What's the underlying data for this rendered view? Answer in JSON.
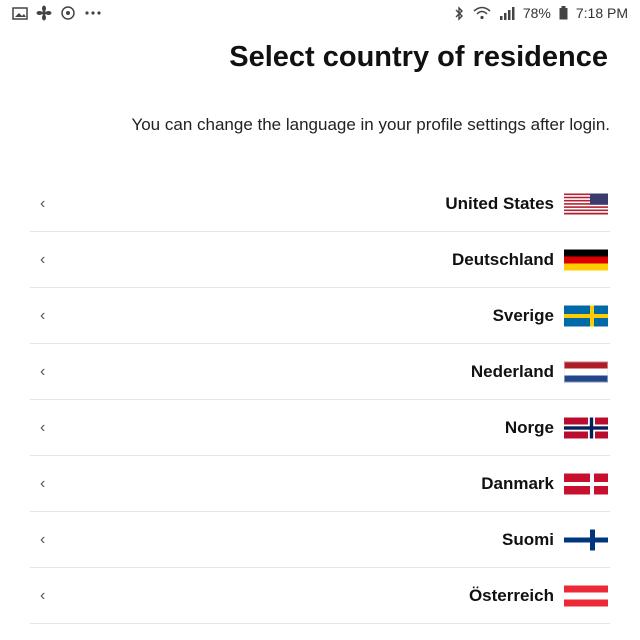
{
  "status_bar": {
    "time": "7:18 PM",
    "battery": "78%",
    "icons": [
      "gallery-icon",
      "fan-icon",
      "hotspot-icon",
      "more-dots-icon",
      "battery-icon",
      "wifi-icon",
      "signal-icon",
      "bluetooth-icon"
    ]
  },
  "header": {
    "title": "Select country of residence",
    "subtitle": "You can change the language in your profile settings after login."
  },
  "countries": [
    {
      "name": "United States",
      "flag": "us-flag-icon"
    },
    {
      "name": "Deutschland",
      "flag": "de-flag-icon"
    },
    {
      "name": "Sverige",
      "flag": "se-flag-icon"
    },
    {
      "name": "Nederland",
      "flag": "nl-flag-icon"
    },
    {
      "name": "Norge",
      "flag": "no-flag-icon"
    },
    {
      "name": "Danmark",
      "flag": "dk-flag-icon"
    },
    {
      "name": "Suomi",
      "flag": "fi-flag-icon"
    },
    {
      "name": "Österreich",
      "flag": "at-flag-icon"
    }
  ],
  "chevron_glyph": "‹",
  "colors": {
    "us_red": "#b22234",
    "us_blue": "#3c3b6e",
    "de_black": "#000000",
    "de_red": "#dd0000",
    "de_gold": "#ffce00",
    "se_blue": "#006aa7",
    "se_yellow": "#fecc00",
    "nl_red": "#ae1c28",
    "nl_blue": "#21468b",
    "no_red": "#ba0c2f",
    "no_blue": "#00205b",
    "dk_red": "#c8102e",
    "fi_blue": "#003580",
    "at_red": "#ed2939",
    "divider": "#e5e5e5"
  }
}
